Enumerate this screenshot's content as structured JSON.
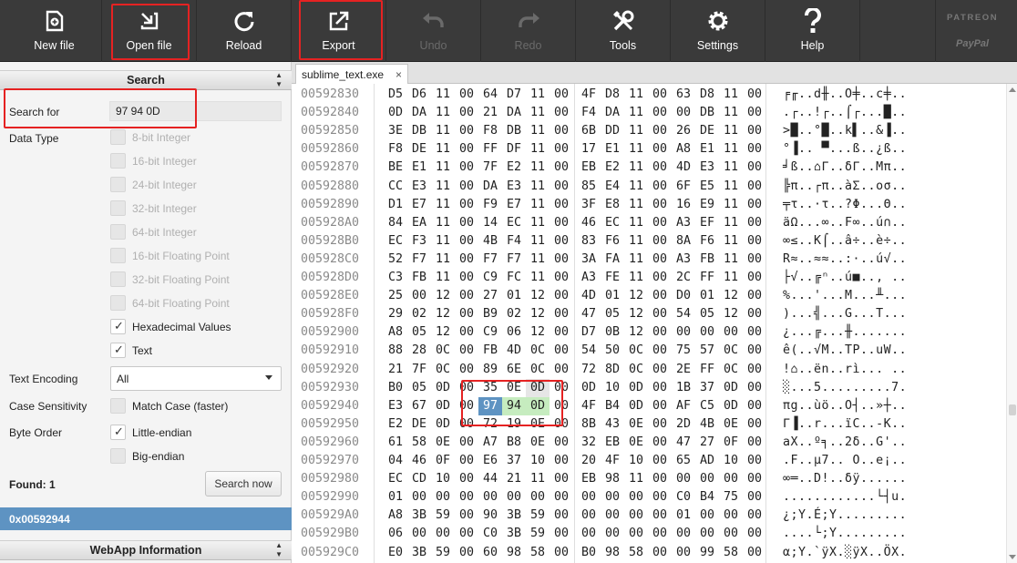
{
  "toolbar": {
    "buttons": [
      {
        "label": "New file",
        "icon": "new-file-icon",
        "enabled": true
      },
      {
        "label": "Open file",
        "icon": "open-file-icon",
        "enabled": true
      },
      {
        "label": "Reload",
        "icon": "reload-icon",
        "enabled": true
      },
      {
        "label": "Export",
        "icon": "export-icon",
        "enabled": true
      },
      {
        "label": "Undo",
        "icon": "undo-icon",
        "enabled": false
      },
      {
        "label": "Redo",
        "icon": "redo-icon",
        "enabled": false
      },
      {
        "label": "Tools",
        "icon": "tools-icon",
        "enabled": true
      },
      {
        "label": "Settings",
        "icon": "gear-icon",
        "enabled": true
      },
      {
        "label": "Help",
        "icon": "help-icon",
        "enabled": true
      }
    ],
    "sponsor": {
      "patreon": "PATREON",
      "paypal": "PayPal"
    }
  },
  "search": {
    "header": "Search",
    "search_for_label": "Search for",
    "search_for_value": "97 94 0D",
    "data_type_label": "Data Type",
    "data_types": [
      {
        "label": "8-bit Integer",
        "checked": false,
        "enabled": false
      },
      {
        "label": "16-bit Integer",
        "checked": false,
        "enabled": false
      },
      {
        "label": "24-bit Integer",
        "checked": false,
        "enabled": false
      },
      {
        "label": "32-bit Integer",
        "checked": false,
        "enabled": false
      },
      {
        "label": "64-bit Integer",
        "checked": false,
        "enabled": false
      },
      {
        "label": "16-bit Floating Point",
        "checked": false,
        "enabled": false
      },
      {
        "label": "32-bit Floating Point",
        "checked": false,
        "enabled": false
      },
      {
        "label": "64-bit Floating Point",
        "checked": false,
        "enabled": false
      },
      {
        "label": "Hexadecimal Values",
        "checked": true,
        "enabled": true
      },
      {
        "label": "Text",
        "checked": true,
        "enabled": true
      }
    ],
    "text_encoding_label": "Text Encoding",
    "text_encoding_value": "All",
    "case_sensitivity_label": "Case Sensitivity",
    "match_case_label": "Match Case (faster)",
    "match_case_checked": false,
    "byte_order_label": "Byte Order",
    "little_endian_label": "Little-endian",
    "little_endian_checked": true,
    "big_endian_label": "Big-endian",
    "big_endian_checked": false,
    "found_label": "Found: 1",
    "search_now_label": "Search now",
    "results": [
      "0x00592944"
    ]
  },
  "webapp_info": {
    "header": "WebApp Information"
  },
  "editor": {
    "tab_name": "sublime_text.exe",
    "tab_close": "×",
    "highlight_colors": {
      "selected": "#5e93c2",
      "match": "#c6ecbf",
      "cursor": "#e6e6e6"
    },
    "rows": [
      {
        "addr": "00592830",
        "bytes": [
          "D5",
          "D6",
          "11",
          "00",
          "64",
          "D7",
          "11",
          "00",
          "4F",
          "D8",
          "11",
          "00",
          "63",
          "D8",
          "11",
          "00"
        ],
        "text": "╒╓..d╫..O╪..c╪.."
      },
      {
        "addr": "00592840",
        "bytes": [
          "0D",
          "DA",
          "11",
          "00",
          "21",
          "DA",
          "11",
          "00",
          "F4",
          "DA",
          "11",
          "00",
          "00",
          "DB",
          "11",
          "00"
        ],
        "text": ".┌..!┌..⌠┌...█.."
      },
      {
        "addr": "00592850",
        "bytes": [
          "3E",
          "DB",
          "11",
          "00",
          "F8",
          "DB",
          "11",
          "00",
          "6B",
          "DD",
          "11",
          "00",
          "26",
          "DE",
          "11",
          "00"
        ],
        "text": ">█..°█..k▌..&▐.."
      },
      {
        "addr": "00592860",
        "bytes": [
          "F8",
          "DE",
          "11",
          "00",
          "FF",
          "DF",
          "11",
          "00",
          "17",
          "E1",
          "11",
          "00",
          "A8",
          "E1",
          "11",
          "00"
        ],
        "text": "°▐.. ▀...ß..¿ß.."
      },
      {
        "addr": "00592870",
        "bytes": [
          "BE",
          "E1",
          "11",
          "00",
          "7F",
          "E2",
          "11",
          "00",
          "EB",
          "E2",
          "11",
          "00",
          "4D",
          "E3",
          "11",
          "00"
        ],
        "text": "╛ß..⌂Γ..δΓ..Mπ.."
      },
      {
        "addr": "00592880",
        "bytes": [
          "CC",
          "E3",
          "11",
          "00",
          "DA",
          "E3",
          "11",
          "00",
          "85",
          "E4",
          "11",
          "00",
          "6F",
          "E5",
          "11",
          "00"
        ],
        "text": "╠π..┌π..àΣ..oσ.."
      },
      {
        "addr": "00592890",
        "bytes": [
          "D1",
          "E7",
          "11",
          "00",
          "F9",
          "E7",
          "11",
          "00",
          "3F",
          "E8",
          "11",
          "00",
          "16",
          "E9",
          "11",
          "00"
        ],
        "text": "╤τ..·τ..?Φ...Θ.."
      },
      {
        "addr": "005928A0",
        "bytes": [
          "84",
          "EA",
          "11",
          "00",
          "14",
          "EC",
          "11",
          "00",
          "46",
          "EC",
          "11",
          "00",
          "A3",
          "EF",
          "11",
          "00"
        ],
        "text": "äΩ...∞..F∞..ú∩.."
      },
      {
        "addr": "005928B0",
        "bytes": [
          "EC",
          "F3",
          "11",
          "00",
          "4B",
          "F4",
          "11",
          "00",
          "83",
          "F6",
          "11",
          "00",
          "8A",
          "F6",
          "11",
          "00"
        ],
        "text": "∞≤..K⌠..â÷..è÷.."
      },
      {
        "addr": "005928C0",
        "bytes": [
          "52",
          "F7",
          "11",
          "00",
          "F7",
          "F7",
          "11",
          "00",
          "3A",
          "FA",
          "11",
          "00",
          "A3",
          "FB",
          "11",
          "00"
        ],
        "text": "R≈..≈≈..:·..ú√.."
      },
      {
        "addr": "005928D0",
        "bytes": [
          "C3",
          "FB",
          "11",
          "00",
          "C9",
          "FC",
          "11",
          "00",
          "A3",
          "FE",
          "11",
          "00",
          "2C",
          "FF",
          "11",
          "00"
        ],
        "text": "├√..╔ⁿ..ú■.., .."
      },
      {
        "addr": "005928E0",
        "bytes": [
          "25",
          "00",
          "12",
          "00",
          "27",
          "01",
          "12",
          "00",
          "4D",
          "01",
          "12",
          "00",
          "D0",
          "01",
          "12",
          "00"
        ],
        "text": "%...'...M...╨..."
      },
      {
        "addr": "005928F0",
        "bytes": [
          "29",
          "02",
          "12",
          "00",
          "B9",
          "02",
          "12",
          "00",
          "47",
          "05",
          "12",
          "00",
          "54",
          "05",
          "12",
          "00"
        ],
        "text": ")...╣...G...T..."
      },
      {
        "addr": "00592900",
        "bytes": [
          "A8",
          "05",
          "12",
          "00",
          "C9",
          "06",
          "12",
          "00",
          "D7",
          "0B",
          "12",
          "00",
          "00",
          "00",
          "00",
          "00"
        ],
        "text": "¿...╔...╫......."
      },
      {
        "addr": "00592910",
        "bytes": [
          "88",
          "28",
          "0C",
          "00",
          "FB",
          "4D",
          "0C",
          "00",
          "54",
          "50",
          "0C",
          "00",
          "75",
          "57",
          "0C",
          "00"
        ],
        "text": "ê(..√M..TP..uW.."
      },
      {
        "addr": "00592920",
        "bytes": [
          "21",
          "7F",
          "0C",
          "00",
          "89",
          "6E",
          "0C",
          "00",
          "72",
          "8D",
          "0C",
          "00",
          "2E",
          "FF",
          "0C",
          "00"
        ],
        "text": "!⌂..ën..rì... .."
      },
      {
        "addr": "00592930",
        "bytes": [
          "B0",
          "05",
          "0D",
          "00",
          "35",
          "0E",
          "0D",
          "00",
          "0D",
          "10",
          "0D",
          "00",
          "1B",
          "37",
          "0D",
          "00"
        ],
        "text": "░...5.........7."
      },
      {
        "addr": "00592940",
        "bytes": [
          "E3",
          "67",
          "0D",
          "00",
          "97",
          "94",
          "0D",
          "00",
          "4F",
          "B4",
          "0D",
          "00",
          "AF",
          "C5",
          "0D",
          "00"
        ],
        "text": "πg..ùö..O┤..»┼.."
      },
      {
        "addr": "00592950",
        "bytes": [
          "E2",
          "DE",
          "0D",
          "00",
          "72",
          "19",
          "0E",
          "00",
          "8B",
          "43",
          "0E",
          "00",
          "2D",
          "4B",
          "0E",
          "00"
        ],
        "text": "Γ▐..r...ïC..-K.."
      },
      {
        "addr": "00592960",
        "bytes": [
          "61",
          "58",
          "0E",
          "00",
          "A7",
          "B8",
          "0E",
          "00",
          "32",
          "EB",
          "0E",
          "00",
          "47",
          "27",
          "0F",
          "00"
        ],
        "text": "aX..º╕..2δ..G'.."
      },
      {
        "addr": "00592970",
        "bytes": [
          "04",
          "46",
          "0F",
          "00",
          "E6",
          "37",
          "10",
          "00",
          "20",
          "4F",
          "10",
          "00",
          "65",
          "AD",
          "10",
          "00"
        ],
        "text": ".F..µ7.. O..e¡.."
      },
      {
        "addr": "00592980",
        "bytes": [
          "EC",
          "CD",
          "10",
          "00",
          "44",
          "21",
          "11",
          "00",
          "EB",
          "98",
          "11",
          "00",
          "00",
          "00",
          "00",
          "00"
        ],
        "text": "∞═..D!..δÿ......"
      },
      {
        "addr": "00592990",
        "bytes": [
          "01",
          "00",
          "00",
          "00",
          "00",
          "00",
          "00",
          "00",
          "00",
          "00",
          "00",
          "00",
          "C0",
          "B4",
          "75",
          "00"
        ],
        "text": "............└┤u."
      },
      {
        "addr": "005929A0",
        "bytes": [
          "A8",
          "3B",
          "59",
          "00",
          "90",
          "3B",
          "59",
          "00",
          "00",
          "00",
          "00",
          "00",
          "01",
          "00",
          "00",
          "00"
        ],
        "text": "¿;Y.É;Y........."
      },
      {
        "addr": "005929B0",
        "bytes": [
          "06",
          "00",
          "00",
          "00",
          "C0",
          "3B",
          "59",
          "00",
          "00",
          "00",
          "00",
          "00",
          "00",
          "00",
          "00",
          "00"
        ],
        "text": "....└;Y........."
      },
      {
        "addr": "005929C0",
        "bytes": [
          "E0",
          "3B",
          "59",
          "00",
          "60",
          "98",
          "58",
          "00",
          "B0",
          "98",
          "58",
          "00",
          "00",
          "99",
          "58",
          "00"
        ],
        "text": "α;Y.`ÿX.░ÿX..ÖX."
      }
    ]
  }
}
